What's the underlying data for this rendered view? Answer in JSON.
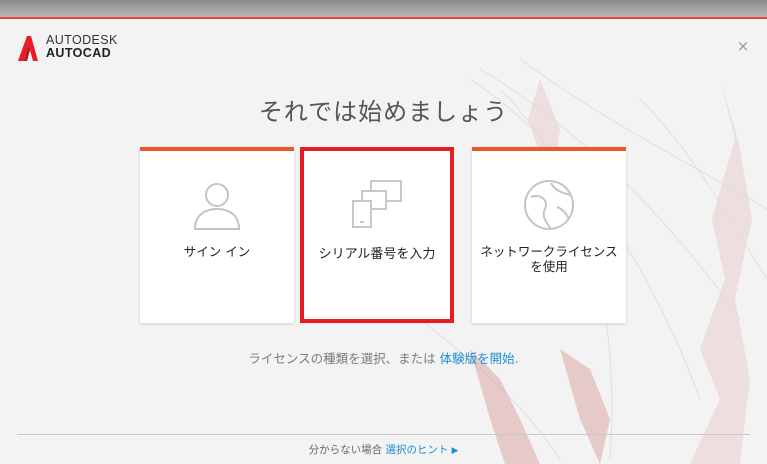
{
  "brand": {
    "line1": "AUTODESK",
    "line2": "AUTOCAD",
    "color": "#e81c24"
  },
  "window": {
    "close_glyph": "×"
  },
  "heading": "それでは始めましょう",
  "options": [
    {
      "label": "サイン イン",
      "icon": "user-icon"
    },
    {
      "label": "シリアル番号を入力",
      "icon": "devices-icon",
      "selected": true
    },
    {
      "label": "ネットワークライセンスを使用",
      "icon": "globe-icon"
    }
  ],
  "subtext": {
    "prefix": "ライセンスの種類を選択、または ",
    "link": "体験版を開始",
    "suffix": "."
  },
  "hint": {
    "prefix": "分からない場合 ",
    "link": "選択のヒント",
    "arrow": "▶"
  },
  "colors": {
    "accent": "#e9572f",
    "selection": "#e81c24",
    "link": "#1b8fd6"
  }
}
